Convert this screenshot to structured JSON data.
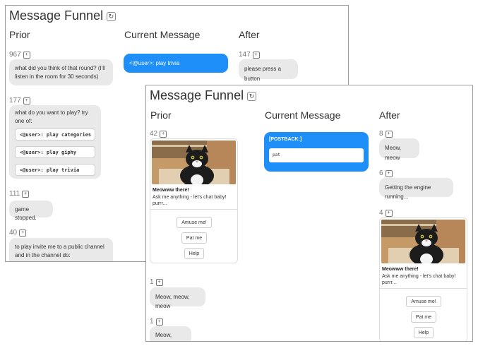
{
  "panels": [
    {
      "title": "Message Funnel",
      "columns": {
        "prior": "Prior",
        "current": "Current Message",
        "after": "After"
      },
      "prior": [
        {
          "count": "967",
          "text": "what did you think of that round? (I'll listen in the room for 30 seconds)"
        },
        {
          "count": "177",
          "text": "what do you want to play? try one of:",
          "commands": [
            "<@user>: play categories",
            "<@user>: play giphy",
            "<@user>: play trivia"
          ]
        },
        {
          "count": "111",
          "text": "game stopped."
        },
        {
          "count": "40",
          "text": "to play invite me to a public channel and in the channel do:"
        }
      ],
      "current": {
        "text": "<@user>: play trivia"
      },
      "after": [
        {
          "count": "147",
          "text": "please press a button"
        }
      ]
    },
    {
      "title": "Message Funnel",
      "columns": {
        "prior": "Prior",
        "current": "Current Message",
        "after": "After"
      },
      "prior_card": {
        "count": "42",
        "title": "Meowww there!",
        "text": "Ask me anything - let's chat baby! purrr...",
        "buttons": [
          "Amuse me!",
          "Pat me",
          "Help"
        ]
      },
      "prior": [
        {
          "count": "1",
          "text": "Meow, meow, meow"
        },
        {
          "count": "1",
          "text": "Meow, meow"
        }
      ],
      "current": {
        "label": "[POSTBACK:]",
        "value": "pat"
      },
      "after": [
        {
          "count": "8",
          "text": "Meow, meow"
        },
        {
          "count": "6",
          "text": "Getting the engine running..."
        }
      ],
      "after_card": {
        "count": "4",
        "title": "Meowww there!",
        "text": "Ask me anything - let's chat baby! purrr...",
        "buttons": [
          "Amuse me!",
          "Pat me",
          "Help"
        ]
      }
    }
  ],
  "icons": {
    "refresh": "refresh-icon",
    "expand": "plus-square-icon",
    "photo": "cat-photo"
  },
  "colors": {
    "accent": "#1e8ef8",
    "bubble": "#e9e9e9",
    "panel_border": "#9a9a9a"
  }
}
